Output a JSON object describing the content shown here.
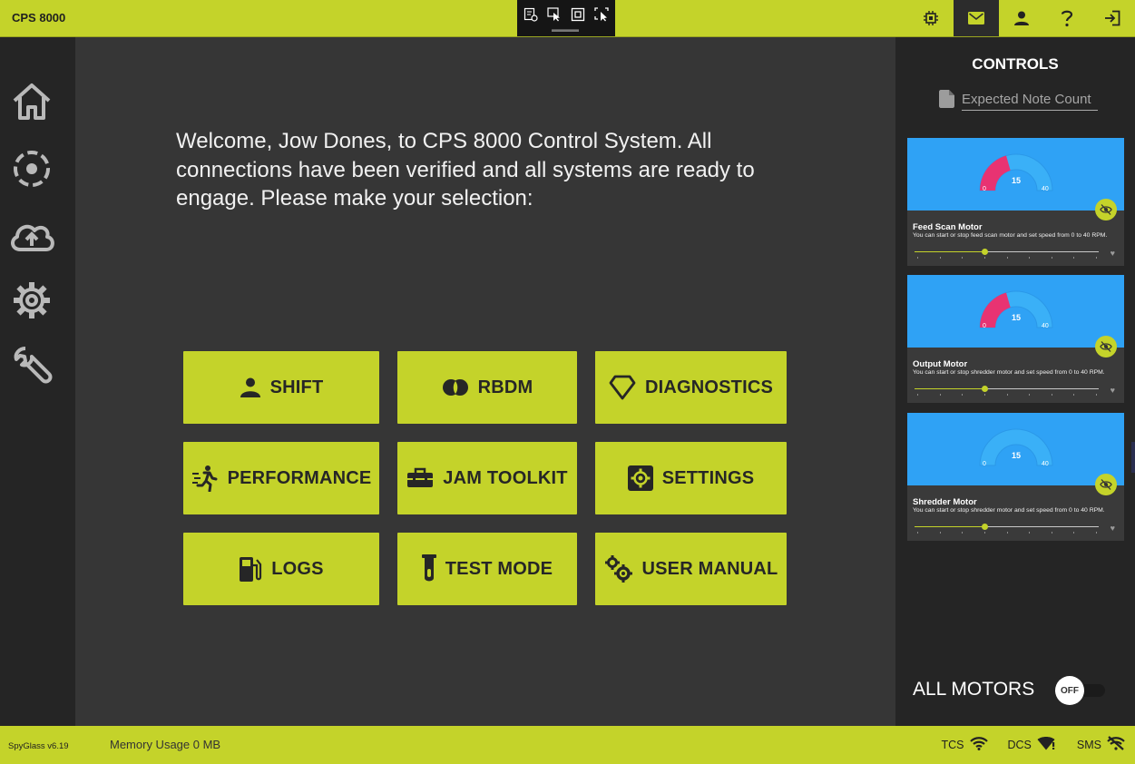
{
  "app": {
    "title": "CPS 8000"
  },
  "dev_toolbar": {
    "tools": [
      "select-element-icon",
      "pointer-icon",
      "frame-icon",
      "screenshot-icon"
    ]
  },
  "top_icons": [
    {
      "name": "chip-icon",
      "active": false
    },
    {
      "name": "mail-icon",
      "active": true
    },
    {
      "name": "user-icon",
      "active": false
    },
    {
      "name": "help-icon",
      "active": false
    },
    {
      "name": "logout-icon",
      "active": false
    }
  ],
  "sidebar": {
    "items": [
      "home-icon",
      "target-icon",
      "cloud-upload-icon",
      "settings-gear-icon",
      "wrench-icon"
    ]
  },
  "main": {
    "welcome": "Welcome, Jow Dones, to CPS 8000 Control System. All connections have been verified and all systems are ready to engage. Please make your selection:",
    "tiles": [
      {
        "label": "SHIFT",
        "icon": "person-icon"
      },
      {
        "label": "RBDM",
        "icon": "rbdm-icon"
      },
      {
        "label": "DIAGNOSTICS",
        "icon": "diamond-icon"
      },
      {
        "label": "PERFORMANCE",
        "icon": "running-icon"
      },
      {
        "label": "JAM TOOLKIT",
        "icon": "toolbox-icon"
      },
      {
        "label": "SETTINGS",
        "icon": "cog-box-icon"
      },
      {
        "label": "LOGS",
        "icon": "fuel-icon"
      },
      {
        "label": "TEST MODE",
        "icon": "test-tube-icon"
      },
      {
        "label": "USER MANUAL",
        "icon": "cogs-icon"
      }
    ]
  },
  "controls": {
    "title": "CONTROLS",
    "expected_note_placeholder": "Expected Note Count",
    "motors": [
      {
        "name": "Feed Scan Motor",
        "description": "You can start or stop feed scan motor and set speed from 0 to 40 RPM.",
        "value": "15",
        "min": "0",
        "max": "40",
        "speed_fraction": 0.38,
        "gauge_fill_fraction": 0.375
      },
      {
        "name": "Output Motor",
        "description": "You can start or stop shredder motor and set speed from 0 to 40 RPM.",
        "value": "15",
        "min": "0",
        "max": "40",
        "speed_fraction": 0.38,
        "gauge_fill_fraction": 0.375
      },
      {
        "name": "Shredder Motor",
        "description": "You can start or stop shredder motor and set speed from 0 to 40 RPM.",
        "value": "15",
        "min": "0",
        "max": "40",
        "speed_fraction": 0.38,
        "gauge_fill_fraction": 0
      }
    ],
    "all_motors_label": "ALL MOTORS",
    "all_motors_state": "OFF"
  },
  "statusbar": {
    "version": "SpyGlass v6.19",
    "memory": "Memory Usage 0 MB",
    "indicators": [
      {
        "label": "TCS",
        "icon": "wifi-icon"
      },
      {
        "label": "DCS",
        "icon": "wifi-alert-icon"
      },
      {
        "label": "SMS",
        "icon": "wifi-off-icon"
      }
    ]
  },
  "colors": {
    "accent": "#c4d32a",
    "gauge_blue": "#2fa2f5",
    "gauge_fill": "#e83372",
    "panel": "#252525",
    "main_bg": "#363636"
  }
}
